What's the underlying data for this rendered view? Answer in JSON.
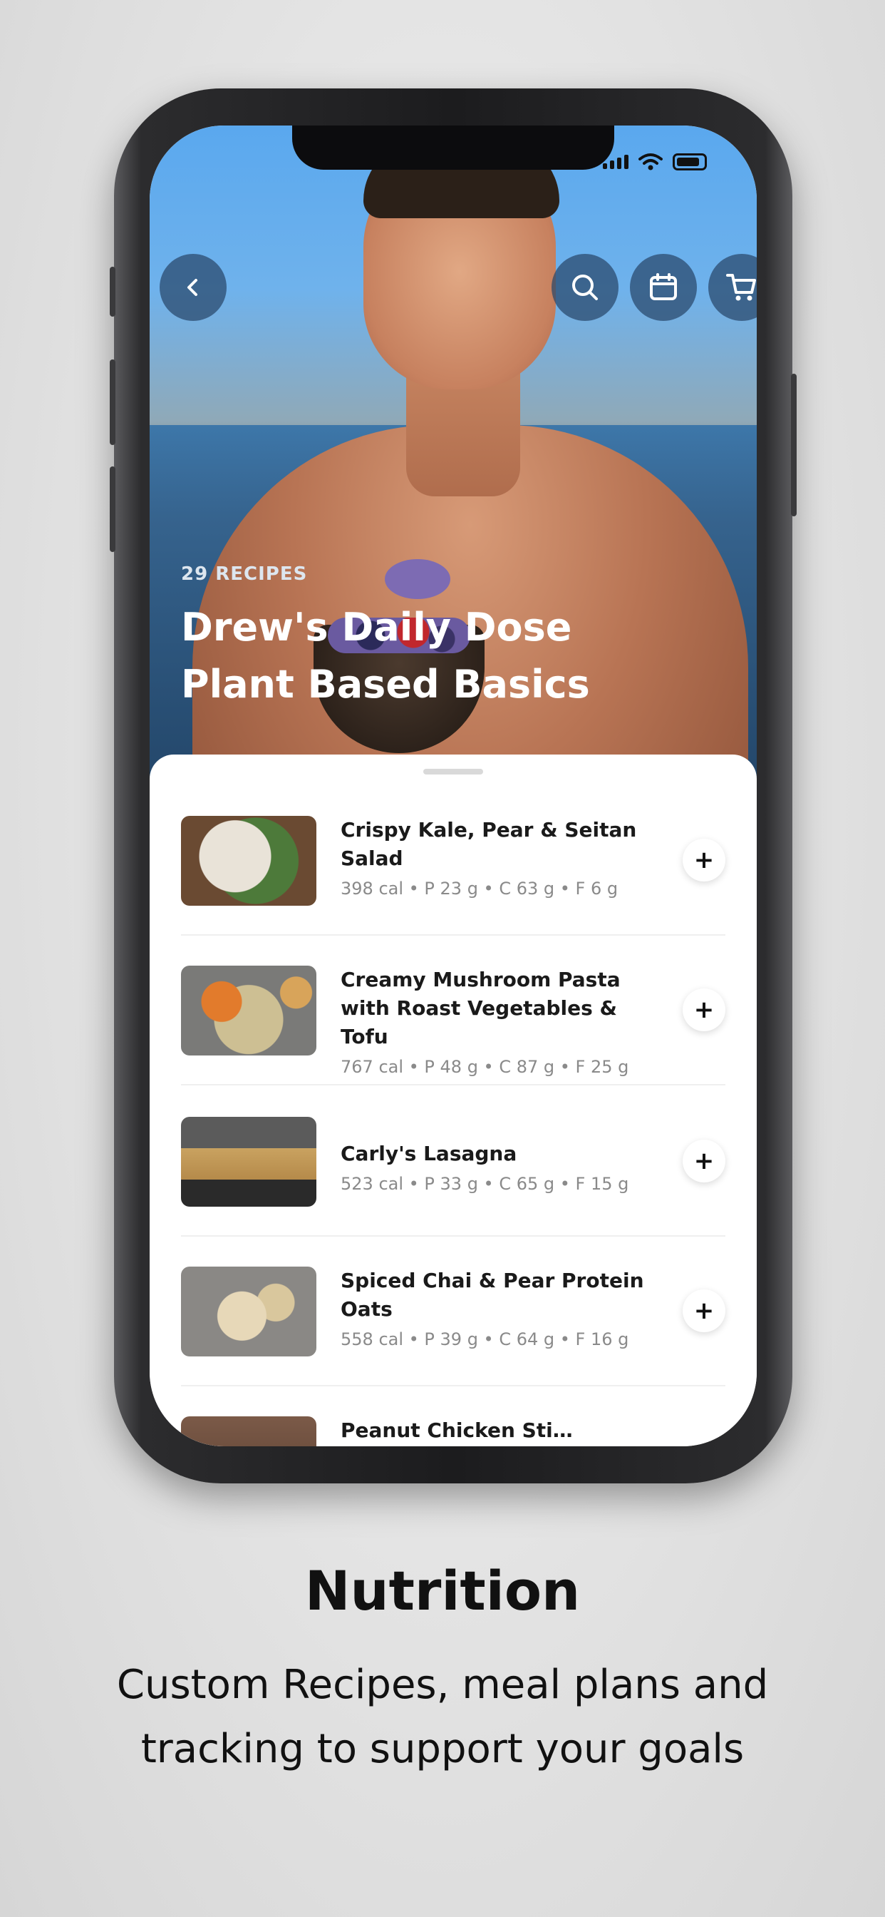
{
  "hero": {
    "count_label": "29 RECIPES",
    "title": "Drew's Daily Dose Plant Based Basics",
    "back_icon": "chevron-left-icon",
    "actions": [
      "search-icon",
      "calendar-icon",
      "cart-icon"
    ]
  },
  "recipes": [
    {
      "title": "Crispy Kale, Pear & Seitan Salad",
      "meta": "398 cal • P 23 g • C 63 g • F 6 g"
    },
    {
      "title": "Creamy Mushroom Pasta with Roast Vegetables & Tofu",
      "meta": "767 cal • P 48 g • C 87 g • F 25 g"
    },
    {
      "title": "Carly's Lasagna",
      "meta": "523 cal • P 33 g • C 65 g • F 15 g"
    },
    {
      "title": "Spiced Chai & Pear Protein Oats",
      "meta": "558 cal • P 39 g • C 64 g • F 16 g"
    },
    {
      "title": "Peanut Chicken Sti…",
      "meta": ""
    }
  ],
  "add_label": "+",
  "caption": {
    "title": "Nutrition",
    "subtitle": "Custom Recipes, meal plans and tracking to support your goals"
  },
  "colors": {
    "overlay_button": "#28466b",
    "title_text": "#ffffff",
    "meta_text": "#8a8a8a"
  }
}
